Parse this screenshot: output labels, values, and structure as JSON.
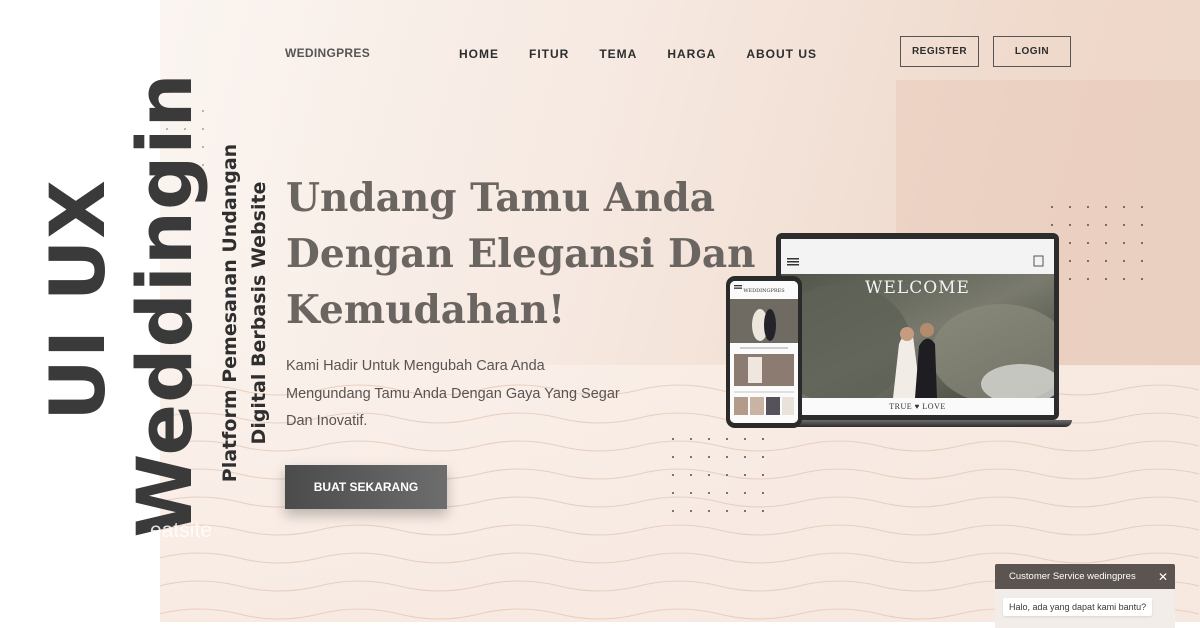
{
  "overlay": {
    "title_line1": "UI UX",
    "title_line2": "Weddingin",
    "subtitle_line1": "Platform Pemesanan Undangan",
    "subtitle_line2": "Digital Berbasis Website",
    "watermark": "eatsite"
  },
  "nav": {
    "brand": "WEDINGPRES",
    "links": [
      "HOME",
      "FITUR",
      "TEMA",
      "HARGA",
      "ABOUT US"
    ],
    "register": "REGISTER",
    "login": "LOGIN"
  },
  "hero": {
    "headline_line1": "Undang Tamu Anda",
    "headline_line2": "Dengan Elegansi Dan",
    "headline_line3": "Kemudahan!",
    "description_line1": "Kami Hadir Untuk Mengubah Cara Anda",
    "description_line2": "Mengundang Tamu Anda Dengan Gaya Yang Segar",
    "description_line3": "Dan Inovatif.",
    "cta": "BUAT SEKARANG"
  },
  "mockup": {
    "welcome": "WELCOME",
    "footer": "TRUE ♥ LOVE",
    "phone_brand": "WEDDINGPRES"
  },
  "chat": {
    "title": "Customer Service wedingpres",
    "message": "Halo, ada yang dapat kami bantu?",
    "close_glyph": "✕"
  },
  "colors": {
    "accent_dark": "#3a3a3a",
    "hero_bg": "#f6e9e1",
    "chat_header": "#5c5450"
  }
}
